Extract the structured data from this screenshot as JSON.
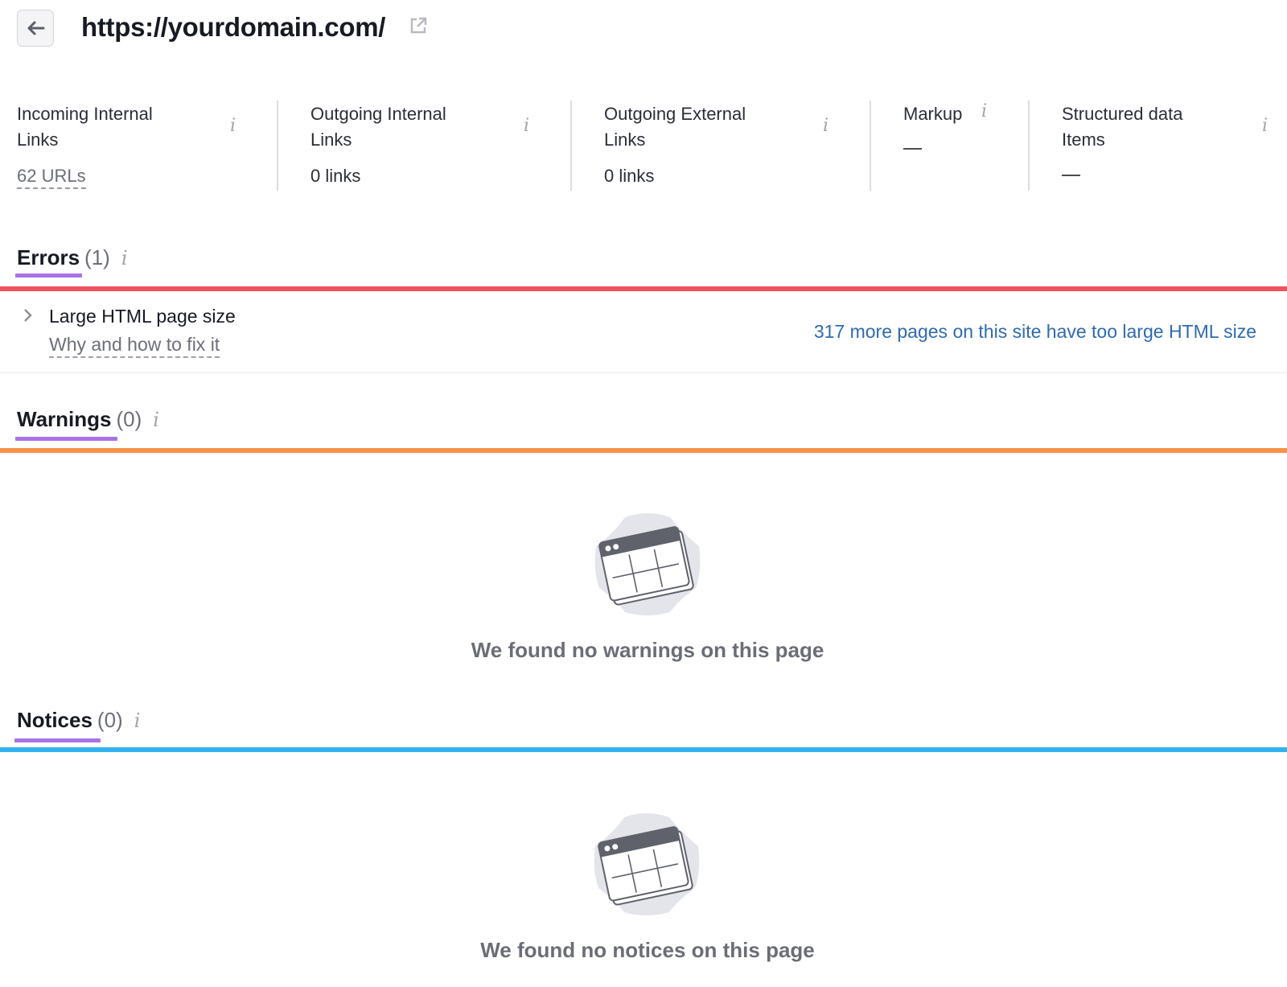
{
  "header": {
    "back_icon": "arrow-left-icon",
    "url": "https://yourdomain.com/",
    "external_icon": "external-link-icon"
  },
  "metrics": [
    {
      "label": "Incoming Internal Links",
      "value": "62 URLs",
      "value_is_link": true,
      "info_icon": "info-icon"
    },
    {
      "label": "Outgoing Internal Links",
      "value": "0 links",
      "info_icon": "info-icon"
    },
    {
      "label": "Outgoing External Links",
      "value": "0 links",
      "info_icon": "info-icon"
    },
    {
      "label": "Markup",
      "value": "—",
      "info_icon": "info-icon"
    },
    {
      "label": "Structured data Items",
      "value": "—",
      "info_icon": "info-icon"
    }
  ],
  "sections": {
    "errors": {
      "title": "Errors",
      "count": "(1)",
      "bar_color": "#f0525f",
      "items": [
        {
          "title": "Large HTML page size",
          "help_link": "Why and how to fix it",
          "more_link": "317 more pages on this site have too large HTML size"
        }
      ]
    },
    "warnings": {
      "title": "Warnings",
      "count": "(0)",
      "bar_color": "#f5924a",
      "empty_message": "We found no warnings on this page",
      "empty_icon": "empty-table-icon"
    },
    "notices": {
      "title": "Notices",
      "count": "(0)",
      "bar_color": "#33b2ef",
      "empty_message": "We found no notices on this page",
      "empty_icon": "empty-table-icon"
    }
  },
  "colors": {
    "tab_underline": "#a873e6",
    "link": "#2f6ab0"
  }
}
